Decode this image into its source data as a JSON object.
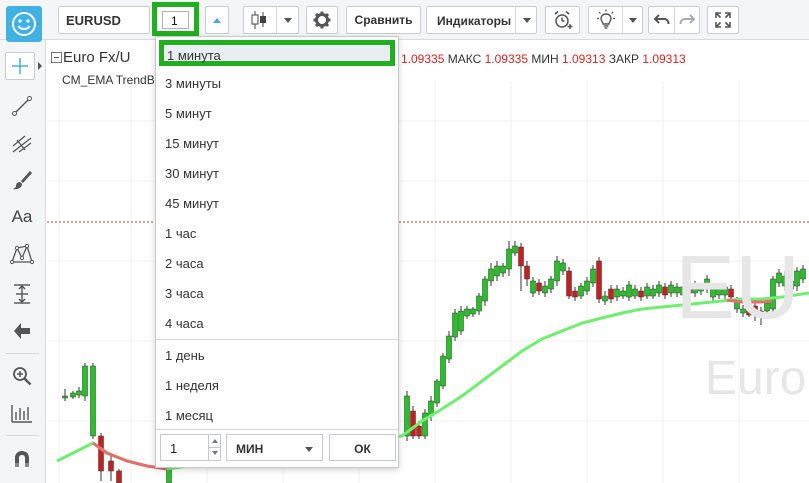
{
  "toolbar": {
    "symbol": "EURUSD",
    "interval_value": "1",
    "compare_label": "Сравнить",
    "indicators_label": "Индикаторы",
    "icons": [
      "smiley-icon",
      "caret-up-icon",
      "candlestick-icon",
      "chevron-down-icon",
      "gear-icon",
      "alarm-icon",
      "bulb-icon",
      "undo-icon",
      "redo-icon",
      "fullscreen-icon"
    ]
  },
  "sidebar": {
    "tools": [
      "crosshair-icon",
      "trendline-icon",
      "pitchfork-icon",
      "brush-icon",
      "text-icon",
      "pattern-icon",
      "measure-icon",
      "arrow-left-icon",
      "zoom-icon",
      "bars-icon",
      "magnet-icon"
    ],
    "text_tool_label": "Aa"
  },
  "chart": {
    "title": "Euro Fx/U",
    "ohlc": {
      "open_value": "1.09335",
      "high_label": "МАКС",
      "high_value": "1.09335",
      "low_label": "МИН",
      "low_value": "1.09313",
      "close_label": "ЗАКР",
      "close_value": "1.09313"
    },
    "indicator_name": "CM_EMA TrendB",
    "watermark_symbol": "EU",
    "watermark_name": "Euro",
    "colors": {
      "up": "#22c322",
      "down": "#c81e1e",
      "ema_up": "#6ef06e",
      "ema_down": "#e86c6c",
      "price_line": "#c0392b"
    }
  },
  "interval_menu": {
    "items": [
      "1 минута",
      "3 минуты",
      "5 минут",
      "15 минут",
      "30 минут",
      "45 минут",
      "1 час",
      "2 часа",
      "3 часа",
      "4 часа",
      "1 день",
      "1 неделя",
      "1 месяц"
    ],
    "selected": "1 минута",
    "custom_value": "1",
    "custom_unit": "МИН",
    "ok_label": "ОК"
  },
  "highlight_color": "#1fb01f"
}
